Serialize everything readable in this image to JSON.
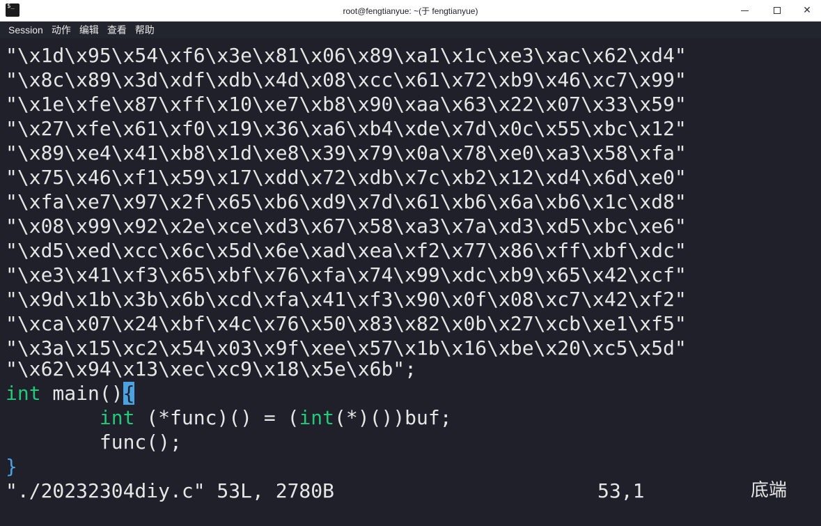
{
  "window": {
    "title": "root@fengtianyue: ~(于 fengtianyue)",
    "app_icon": "$_"
  },
  "menu": [
    "Session",
    "动作",
    "编辑",
    "查看",
    "帮助"
  ],
  "code": {
    "string_lines": [
      "\\x1d\\x95\\x54\\xf6\\x3e\\x81\\x06\\x89\\xa1\\x1c\\xe3\\xac\\x62\\xd4",
      "\\x8c\\x89\\x3d\\xdf\\xdb\\x4d\\x08\\xcc\\x61\\x72\\xb9\\x46\\xc7\\x99",
      "\\x1e\\xfe\\x87\\xff\\x10\\xe7\\xb8\\x90\\xaa\\x63\\x22\\x07\\x33\\x59",
      "\\x27\\xfe\\x61\\xf0\\x19\\x36\\xa6\\xb4\\xde\\x7d\\x0c\\x55\\xbc\\x12",
      "\\x89\\xe4\\x41\\xb8\\x1d\\xe8\\x39\\x79\\x0a\\x78\\xe0\\xa3\\x58\\xfa",
      "\\x75\\x46\\xf1\\x59\\x17\\xdd\\x72\\xdb\\x7c\\xb2\\x12\\xd4\\x6d\\xe0",
      "\\xfa\\xe7\\x97\\x2f\\x65\\xb6\\xd9\\x7d\\x61\\xb6\\x6a\\xb6\\x1c\\xd8",
      "\\x08\\x99\\x92\\x2e\\xce\\xd3\\x67\\x58\\xa3\\x7a\\xd3\\xd5\\xbc\\xe6",
      "\\xd5\\xed\\xcc\\x6c\\x5d\\x6e\\xad\\xea\\xf2\\x77\\x86\\xff\\xbf\\xdc",
      "\\xe3\\x41\\xf3\\x65\\xbf\\x76\\xfa\\x74\\x99\\xdc\\xb9\\x65\\x42\\xcf",
      "\\x9d\\x1b\\x3b\\x6b\\xcd\\xfa\\x41\\xf3\\x90\\x0f\\x08\\xc7\\x42\\xf2",
      "\\xca\\x07\\x24\\xbf\\x4c\\x76\\x50\\x83\\x82\\x0b\\x27\\xcb\\xe1\\xf5",
      "\\x3a\\x15\\xc2\\x54\\x03\\x9f\\xee\\x57\\x1b\\x16\\xbe\\x20\\xc5\\x5d"
    ],
    "last_string": "\\x62\\x94\\x13\\xec\\xc9\\x18\\x5e\\x6b",
    "main_kw": "int",
    "main_rest": " main()",
    "main_brace": "{",
    "body1_indent": "        ",
    "body1_kw": "int",
    "body1_mid": " (*func)() = (",
    "body1_kw2": "int",
    "body1_end": "(*)())buf;",
    "body2": "        func();",
    "close_brace": "}"
  },
  "status": {
    "file_info": "\"./20232304diy.c\" 53L, 2780B",
    "position": "53,1",
    "scroll": "底端"
  },
  "colors": {
    "background": "#1f2029",
    "keyword": "#22c97a",
    "cursor": "#4aa3e0"
  }
}
